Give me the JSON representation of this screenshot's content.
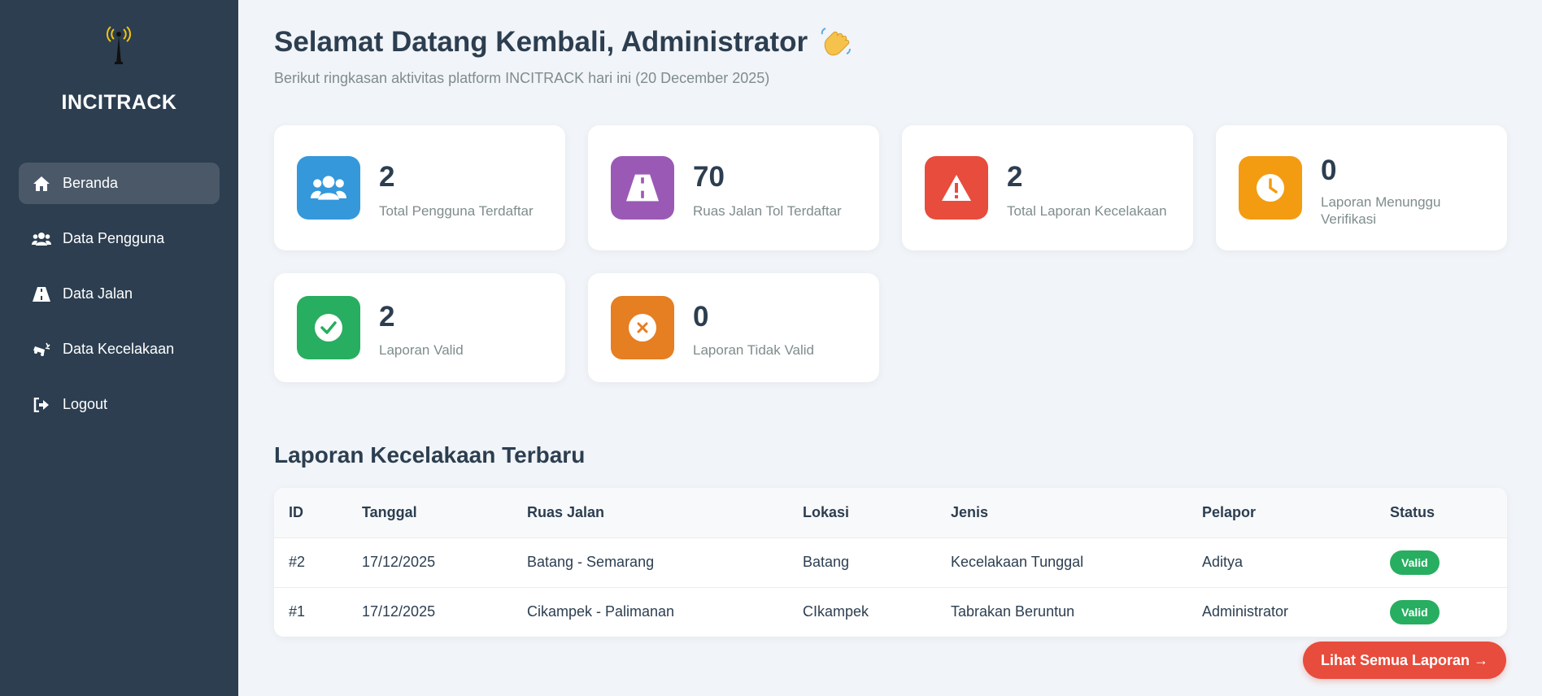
{
  "sidebar": {
    "brand": "INCITRACK",
    "logo_icon": "antenna-tower-icon",
    "items": [
      {
        "label": "Beranda",
        "icon": "home-icon",
        "active": true
      },
      {
        "label": "Data Pengguna",
        "icon": "users-icon",
        "active": false
      },
      {
        "label": "Data Jalan",
        "icon": "road-icon",
        "active": false
      },
      {
        "label": "Data Kecelakaan",
        "icon": "car-crash-icon",
        "active": false
      },
      {
        "label": "Logout",
        "icon": "logout-icon",
        "active": false
      }
    ]
  },
  "header": {
    "title": "Selamat Datang Kembali, Administrator",
    "emoji_icon": "waving-hand-icon",
    "subtitle": "Berikut ringkasan aktivitas platform INCITRACK hari ini (20 December 2025)"
  },
  "stats": [
    {
      "value": "2",
      "label": "Total Pengguna Terdaftar",
      "icon": "users-icon",
      "color": "#3498db"
    },
    {
      "value": "70",
      "label": "Ruas Jalan Tol Terdaftar",
      "icon": "road-icon",
      "color": "#9b59b6"
    },
    {
      "value": "2",
      "label": "Total Laporan Kecelakaan",
      "icon": "warning-icon",
      "color": "#e74c3c"
    },
    {
      "value": "0",
      "label": "Laporan Menunggu Verifikasi",
      "icon": "clock-icon",
      "color": "#f39c12"
    },
    {
      "value": "2",
      "label": "Laporan Valid",
      "icon": "check-circle-icon",
      "color": "#27ae60"
    },
    {
      "value": "0",
      "label": "Laporan Tidak Valid",
      "icon": "x-circle-icon",
      "color": "#e67e22"
    }
  ],
  "recent": {
    "title": "Laporan Kecelakaan Terbaru",
    "columns": [
      "ID",
      "Tanggal",
      "Ruas Jalan",
      "Lokasi",
      "Jenis",
      "Pelapor",
      "Status"
    ],
    "rows": [
      [
        "#2",
        "17/12/2025",
        "Batang - Semarang",
        "Batang",
        "Kecelakaan Tunggal",
        "Aditya",
        "Valid"
      ],
      [
        "#1",
        "17/12/2025",
        "Cikampek - Palimanan",
        "CIkampek",
        "Tabrakan Beruntun",
        "Administrator",
        "Valid"
      ]
    ],
    "status_color": "#27ae60",
    "see_all_label": "Lihat Semua Laporan →"
  }
}
